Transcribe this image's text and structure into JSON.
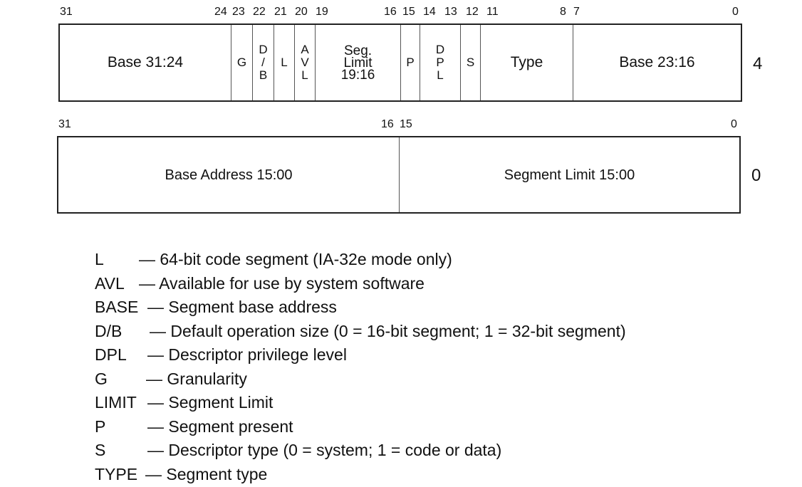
{
  "descriptor_high": {
    "offset_label": "4",
    "bit_numbers": [
      "31",
      "24",
      "23",
      "22",
      "21",
      "20",
      "19",
      "16",
      "15",
      "14",
      "13",
      "12",
      "11",
      "8",
      "7",
      "0"
    ],
    "fields": [
      {
        "name": "base-31-24",
        "label": "Base 31:24",
        "bits": "31:24"
      },
      {
        "name": "g",
        "label": "G",
        "bits": "23"
      },
      {
        "name": "db",
        "lines": [
          "D",
          "/",
          "B"
        ],
        "bits": "22"
      },
      {
        "name": "l",
        "label": "L",
        "bits": "21"
      },
      {
        "name": "avl",
        "lines": [
          "A",
          "V",
          "L"
        ],
        "bits": "20"
      },
      {
        "name": "seg-limit-19-16",
        "lines": [
          "Seg.",
          "Limit",
          "19:16"
        ],
        "bits": "19:16"
      },
      {
        "name": "p",
        "label": "P",
        "bits": "15"
      },
      {
        "name": "dpl",
        "lines": [
          "D",
          "P",
          "L"
        ],
        "bits": "14:13"
      },
      {
        "name": "s",
        "label": "S",
        "bits": "12"
      },
      {
        "name": "type",
        "label": "Type",
        "bits": "11:8"
      },
      {
        "name": "base-23-16",
        "label": "Base 23:16",
        "bits": "7:0"
      }
    ]
  },
  "descriptor_low": {
    "offset_label": "0",
    "bit_numbers": [
      "31",
      "16",
      "15",
      "0"
    ],
    "fields": [
      {
        "name": "base-address-15-00",
        "label": "Base Address 15:00",
        "bits": "31:16"
      },
      {
        "name": "segment-limit-15-00",
        "label": "Segment Limit 15:00",
        "bits": "15:0"
      }
    ]
  },
  "legend": [
    {
      "key": "L",
      "desc": "— 64-bit code segment (IA-32e mode only)"
    },
    {
      "key": "AVL",
      "desc": "— Available for use by system software"
    },
    {
      "key": "BASE",
      "desc": "— Segment base address"
    },
    {
      "key": "D/B",
      "desc": "— Default operation size (0 = 16-bit segment; 1 = 32-bit segment)"
    },
    {
      "key": "DPL",
      "desc": "— Descriptor privilege level"
    },
    {
      "key": "G",
      "desc": "— Granularity"
    },
    {
      "key": "LIMIT",
      "desc": "— Segment Limit"
    },
    {
      "key": "P",
      "desc": "— Segment present"
    },
    {
      "key": "S",
      "desc": "— Descriptor type (0 = system; 1 = code or data)"
    },
    {
      "key": "TYPE",
      "desc": "— Segment type"
    }
  ]
}
